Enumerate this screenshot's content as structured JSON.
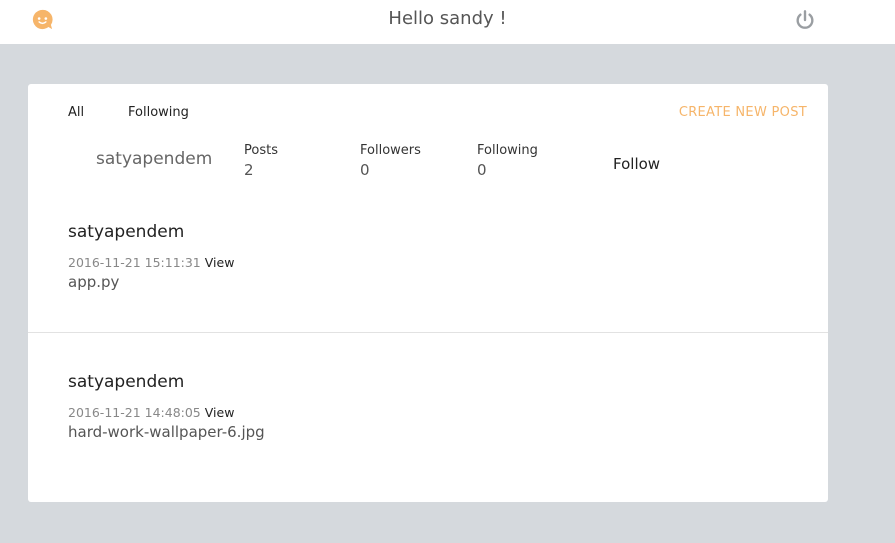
{
  "header": {
    "greeting": "Hello sandy !",
    "logo_icon": "chat-smiley-icon",
    "power_icon": "power-icon",
    "accent_color": "#f6b56a"
  },
  "tabs": [
    {
      "label": "All"
    },
    {
      "label": "Following"
    }
  ],
  "create_post_label": "CREATE NEW POST",
  "profile": {
    "name": "satyapendem",
    "stats": [
      {
        "label": "Posts",
        "value": "2"
      },
      {
        "label": "Followers",
        "value": "0"
      },
      {
        "label": "Following",
        "value": "0"
      }
    ],
    "follow_label": "Follow"
  },
  "posts": [
    {
      "author": "satyapendem",
      "timestamp": "2016-11-21 15:11:31",
      "view_label": "View",
      "file": "app.py"
    },
    {
      "author": "satyapendem",
      "timestamp": "2016-11-21 14:48:05",
      "view_label": "View",
      "file": "hard-work-wallpaper-6.jpg"
    }
  ]
}
